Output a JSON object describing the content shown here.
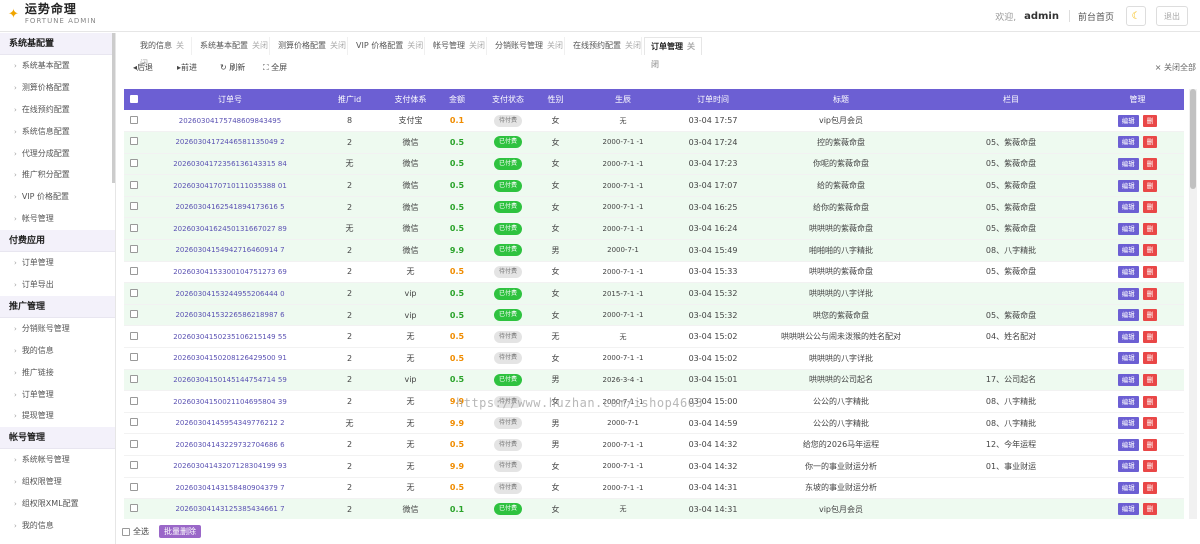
{
  "header": {
    "logo_title": "运势命理",
    "logo_subtitle": "FORTUNE ADMIN",
    "welcome": "欢迎,",
    "username": "admin",
    "frontpage": "前台首页",
    "logout": "退出"
  },
  "sidebar": {
    "groups": [
      {
        "label": "系统基配置",
        "items": [
          "系统基本配置",
          "测算价格配置",
          "在线预约配置",
          "系统信息配置",
          "代理分成配置",
          "推广积分配置",
          "VIP 价格配置",
          "帐号管理"
        ]
      },
      {
        "label": "付费应用",
        "items": [
          "订单管理",
          "订单导出"
        ]
      },
      {
        "label": "推广管理",
        "items": [
          "分销账号管理",
          "我的信息",
          "推广链接",
          "订单管理",
          "提现管理"
        ]
      },
      {
        "label": "帐号管理",
        "items": [
          "系统帐号管理",
          "组权限管理",
          "组权限XML配置",
          "我的信息"
        ]
      }
    ]
  },
  "tabs": [
    {
      "label": "我的信息",
      "close": "关闭"
    },
    {
      "label": "系统基本配置",
      "close": "关闭"
    },
    {
      "label": "测算价格配置",
      "close": "关闭"
    },
    {
      "label": "VIP 价格配置",
      "close": "关闭"
    },
    {
      "label": "帐号管理",
      "close": "关闭"
    },
    {
      "label": "分销账号管理",
      "close": "关闭"
    },
    {
      "label": "在线预约配置",
      "close": "关闭"
    },
    {
      "label": "订单管理",
      "close": "关闭"
    }
  ],
  "toolbar": {
    "back": "◂后退",
    "forward": "▸前进",
    "refresh": "↻ 刷新",
    "fullscreen": "⛶ 全屏",
    "close_all": "× 关闭全部"
  },
  "table": {
    "headers": [
      "订单号",
      "推广id",
      "支付体系",
      "金额",
      "支付状态",
      "性别",
      "生辰",
      "订单时间",
      "标题",
      "栏目",
      "管理"
    ],
    "edit_label": "编辑",
    "delete_label": "删",
    "rows": [
      {
        "order_no": "20260304175748609843495",
        "promo": "8",
        "pay": "支付宝",
        "amount": "0.1",
        "status": "待付费",
        "paid": false,
        "gender": "女",
        "birth": "无",
        "time": "03-04 17:57",
        "title": "vip包月会员",
        "column": ""
      },
      {
        "order_no": "20260304172446581135049 2",
        "promo": "2",
        "pay": "微信",
        "amount": "0.5",
        "status": "已付费",
        "paid": true,
        "gender": "女",
        "birth": "2000-7-1 -1",
        "time": "03-04 17:24",
        "title": "控的紫薇命盘",
        "column": "05、紫薇命盘"
      },
      {
        "order_no": "20260304172356136143315 84",
        "promo": "无",
        "pay": "微信",
        "amount": "0.5",
        "status": "已付费",
        "paid": true,
        "gender": "女",
        "birth": "2000-7-1 -1",
        "time": "03-04 17:23",
        "title": "你呢的紫薇命盘",
        "column": "05、紫薇命盘"
      },
      {
        "order_no": "20260304170710111035388 01",
        "promo": "2",
        "pay": "微信",
        "amount": "0.5",
        "status": "已付费",
        "paid": true,
        "gender": "女",
        "birth": "2000-7-1 -1",
        "time": "03-04 17:07",
        "title": "给的紫薇命盘",
        "column": "05、紫薇命盘"
      },
      {
        "order_no": "20260304162541894173616 5",
        "promo": "2",
        "pay": "微信",
        "amount": "0.5",
        "status": "已付费",
        "paid": true,
        "gender": "女",
        "birth": "2000-7-1 -1",
        "time": "03-04 16:25",
        "title": "给你的紫薇命盘",
        "column": "05、紫薇命盘"
      },
      {
        "order_no": "20260304162450131667027 89",
        "promo": "无",
        "pay": "微信",
        "amount": "0.5",
        "status": "已付费",
        "paid": true,
        "gender": "女",
        "birth": "2000-7-1 -1",
        "time": "03-04 16:24",
        "title": "哄哄哄的紫薇命盘",
        "column": "05、紫薇命盘"
      },
      {
        "order_no": "20260304154942716460914 7",
        "promo": "2",
        "pay": "微信",
        "amount": "9.9",
        "status": "已付费",
        "paid": true,
        "gender": "男",
        "birth": "2000-7-1",
        "time": "03-04 15:49",
        "title": "啪啪啪的八字精批",
        "column": "08、八字精批"
      },
      {
        "order_no": "20260304153300104751273 69",
        "promo": "2",
        "pay": "无",
        "amount": "0.5",
        "status": "待付费",
        "paid": false,
        "gender": "女",
        "birth": "2000-7-1 -1",
        "time": "03-04 15:33",
        "title": "哄哄哄的紫薇命盘",
        "column": "05、紫薇命盘"
      },
      {
        "order_no": "20260304153244955206444 0",
        "promo": "2",
        "pay": "vip",
        "amount": "0.5",
        "status": "已付费",
        "paid": true,
        "gender": "女",
        "birth": "2015-7-1 -1",
        "time": "03-04 15:32",
        "title": "哄哄哄的八字详批",
        "column": ""
      },
      {
        "order_no": "20260304153226586218987 6",
        "promo": "2",
        "pay": "vip",
        "amount": "0.5",
        "status": "已付费",
        "paid": true,
        "gender": "女",
        "birth": "2000-7-1 -1",
        "time": "03-04 15:32",
        "title": "哄您的紫薇命盘",
        "column": "05、紫薇命盘"
      },
      {
        "order_no": "20260304150235106215149 55",
        "promo": "2",
        "pay": "无",
        "amount": "0.5",
        "status": "待付费",
        "paid": false,
        "gender": "无",
        "birth": "无",
        "time": "03-04 15:02",
        "title": "哄哄哄公公与闹未泼猴的姓名配对",
        "column": "04、姓名配对"
      },
      {
        "order_no": "20260304150208126429500 91",
        "promo": "2",
        "pay": "无",
        "amount": "0.5",
        "status": "待付费",
        "paid": false,
        "gender": "女",
        "birth": "2000-7-1 -1",
        "time": "03-04 15:02",
        "title": "哄哄哄的八字详批",
        "column": ""
      },
      {
        "order_no": "20260304150145144754714 59",
        "promo": "2",
        "pay": "vip",
        "amount": "0.5",
        "status": "已付费",
        "paid": true,
        "gender": "男",
        "birth": "2026-3-4 -1",
        "time": "03-04 15:01",
        "title": "哄哄哄的公司起名",
        "column": "17、公司起名"
      },
      {
        "order_no": "20260304150021104695804 39",
        "promo": "2",
        "pay": "无",
        "amount": "9.9",
        "status": "待付费",
        "paid": false,
        "gender": "女",
        "birth": "2000-7-1 -1",
        "time": "03-04 15:00",
        "title": "公公的八字精批",
        "column": "08、八字精批"
      },
      {
        "order_no": "20260304145954349776212 2",
        "promo": "无",
        "pay": "无",
        "amount": "9.9",
        "status": "待付费",
        "paid": false,
        "gender": "男",
        "birth": "2000-7-1",
        "time": "03-04 14:59",
        "title": "公公的八字精批",
        "column": "08、八字精批"
      },
      {
        "order_no": "20260304143229732704686 6",
        "promo": "2",
        "pay": "无",
        "amount": "0.5",
        "status": "待付费",
        "paid": false,
        "gender": "男",
        "birth": "2000-7-1 -1",
        "time": "03-04 14:32",
        "title": "给您的2026马年运程",
        "column": "12、今年运程"
      },
      {
        "order_no": "20260304143207128304199 93",
        "promo": "2",
        "pay": "无",
        "amount": "9.9",
        "status": "待付费",
        "paid": false,
        "gender": "女",
        "birth": "2000-7-1 -1",
        "time": "03-04 14:32",
        "title": "你一的事业财运分析",
        "column": "01、事业财运"
      },
      {
        "order_no": "20260304143158480904379 7",
        "promo": "2",
        "pay": "无",
        "amount": "0.5",
        "status": "待付费",
        "paid": false,
        "gender": "女",
        "birth": "2000-7-1 -1",
        "time": "03-04 14:31",
        "title": "东坡的事业财运分析",
        "column": ""
      },
      {
        "order_no": "20260304143125385434661 7",
        "promo": "2",
        "pay": "微信",
        "amount": "0.1",
        "status": "已付费",
        "paid": true,
        "gender": "女",
        "birth": "无",
        "time": "03-04 14:31",
        "title": "vip包月会员",
        "column": ""
      }
    ]
  },
  "bottom": {
    "select_all": "全选",
    "bulk_delete": "批量删除"
  },
  "watermark": "https://www.huzhan.com/ishop4663"
}
